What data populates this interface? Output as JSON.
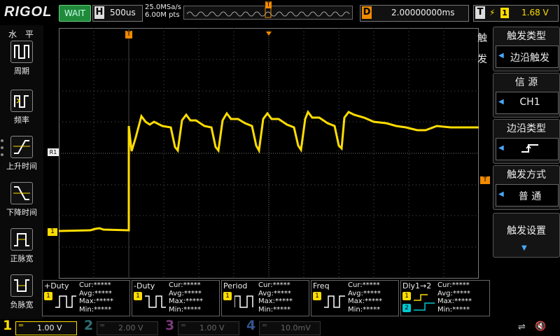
{
  "top": {
    "brand": "RIGOL",
    "status": "WAIT",
    "h_key": "H",
    "timebase": "500us",
    "sample_rate": "25.0MSa/s",
    "mem_depth": "6.00M pts",
    "mem_marker": "T",
    "delay_key": "D",
    "delay": "2.00000000ms",
    "trig_key": "T",
    "trig_edge_icon": "rising-edge-icon",
    "trig_source": "1",
    "trig_level": "1.68 V"
  },
  "left_panel": {
    "title": "水 平",
    "items": [
      {
        "label": "周期",
        "icon": "period-icon"
      },
      {
        "label": "频率",
        "icon": "frequency-icon"
      },
      {
        "label": "上升时间",
        "icon": "rise-time-icon"
      },
      {
        "label": "下降时间",
        "icon": "fall-time-icon"
      },
      {
        "label": "正脉宽",
        "icon": "positive-width-icon"
      },
      {
        "label": "负脉宽",
        "icon": "negative-width-icon"
      }
    ]
  },
  "grid": {
    "trigger_pos_marker": "T",
    "ref_marker": "R1",
    "ch1_marker": "1",
    "trig_level_marker": "T",
    "trace_color": "#ffdd00",
    "waveform_note": "CH1 low ~ -1.0div until trigger, then ringing pulses, settling high"
  },
  "menu": {
    "side_label_1": "触",
    "side_label_2": "发",
    "items": [
      {
        "title": "触发类型",
        "value": "边沿触发"
      },
      {
        "title": "信 源",
        "value": "CH1"
      },
      {
        "title": "边沿类型",
        "value": ""
      },
      {
        "title": "触发方式",
        "value": "普 通"
      },
      {
        "title": "触发设置",
        "value": ""
      }
    ]
  },
  "measurements": [
    {
      "name": "+Duty",
      "cur": "Cur:*****",
      "avg": "Avg:*****",
      "max": "Max:*****",
      "min": "Min:*****",
      "src": "1"
    },
    {
      "name": "-Duty",
      "cur": "Cur:*****",
      "avg": "Avg:*****",
      "max": "Max:*****",
      "min": "Min:*****",
      "src": "1"
    },
    {
      "name": "Period",
      "cur": "Cur:*****",
      "avg": "Avg:*****",
      "max": "Max:*****",
      "min": "Min:*****",
      "src": "1"
    },
    {
      "name": "Freq",
      "cur": "Cur:*****",
      "avg": "Avg:*****",
      "max": "Max:*****",
      "min": "Min:*****",
      "src": "1"
    },
    {
      "name": "Dly1→2",
      "cur": "Cur:*****",
      "avg": "Avg:*****",
      "max": "Max:*****",
      "min": "Min:*****",
      "src": "1",
      "src2": "2"
    }
  ],
  "channels": [
    {
      "num": "1",
      "scale": "1.00 V",
      "color": "#ffdd00",
      "active": true
    },
    {
      "num": "2",
      "scale": "2.00 V",
      "color": "#2f9fa5",
      "active": false
    },
    {
      "num": "3",
      "scale": "1.00 V",
      "color": "#a64aa6",
      "active": false
    },
    {
      "num": "4",
      "scale": "10.0mV",
      "color": "#3a5fa8",
      "active": false
    }
  ],
  "colors": {
    "ch1": "#ffdd00",
    "accent": "#f08a00",
    "menu_arrow": "#4aa8ff"
  }
}
